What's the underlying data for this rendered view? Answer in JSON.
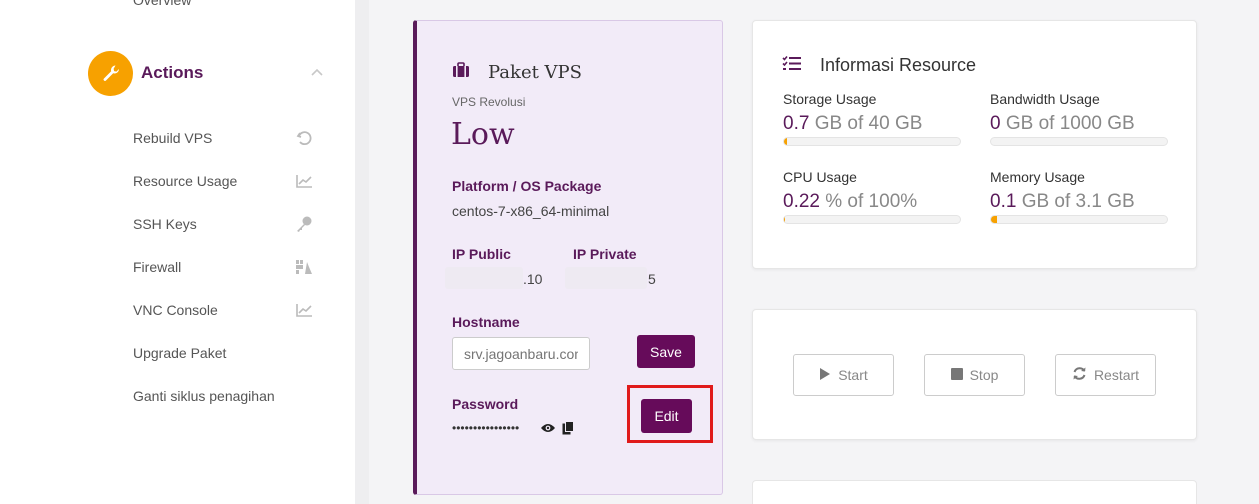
{
  "sidebar": {
    "top_item": "Overview",
    "section_label": "Actions",
    "items": [
      {
        "label": "Rebuild VPS",
        "icon": "undo-icon"
      },
      {
        "label": "Resource Usage",
        "icon": "chart-icon"
      },
      {
        "label": "SSH Keys",
        "icon": "key-icon"
      },
      {
        "label": "Firewall",
        "icon": "firewall-icon"
      },
      {
        "label": "VNC Console",
        "icon": "chart-icon"
      },
      {
        "label": "Upgrade Paket",
        "icon": ""
      },
      {
        "label": "Ganti siklus penagihan",
        "icon": ""
      }
    ]
  },
  "paket": {
    "title": "Paket VPS",
    "subtitle": "VPS Revolusi",
    "plan": "Low",
    "platform_label": "Platform / OS Package",
    "platform_value": "centos-7-x86_64-minimal",
    "ip_public_label": "IP Public",
    "ip_public_value": ".10",
    "ip_private_label": "IP Private",
    "ip_private_value": "5",
    "hostname_label": "Hostname",
    "hostname_placeholder": "srv.jagoanbaru.com",
    "save_label": "Save",
    "password_label": "Password",
    "password_mask": "••••••••••••••••",
    "edit_label": "Edit"
  },
  "resource": {
    "title": "Informasi Resource",
    "items": [
      {
        "label": "Storage Usage",
        "value": "0.7",
        "suffix": " GB of 40 GB",
        "percent": 1.75
      },
      {
        "label": "Bandwidth Usage",
        "value": "0",
        "suffix": " GB of 1000 GB",
        "percent": 0
      },
      {
        "label": "CPU Usage",
        "value": "0.22",
        "suffix": " % of 100%",
        "percent": 0.22
      },
      {
        "label": "Memory Usage",
        "value": "0.1",
        "suffix": " GB of 3.1 GB",
        "percent": 3.2
      }
    ]
  },
  "controls": {
    "start": "Start",
    "stop": "Stop",
    "restart": "Restart"
  },
  "colors": {
    "accent": "#f7a100",
    "brand": "#660b5a",
    "highlight": "#e01a1a"
  }
}
